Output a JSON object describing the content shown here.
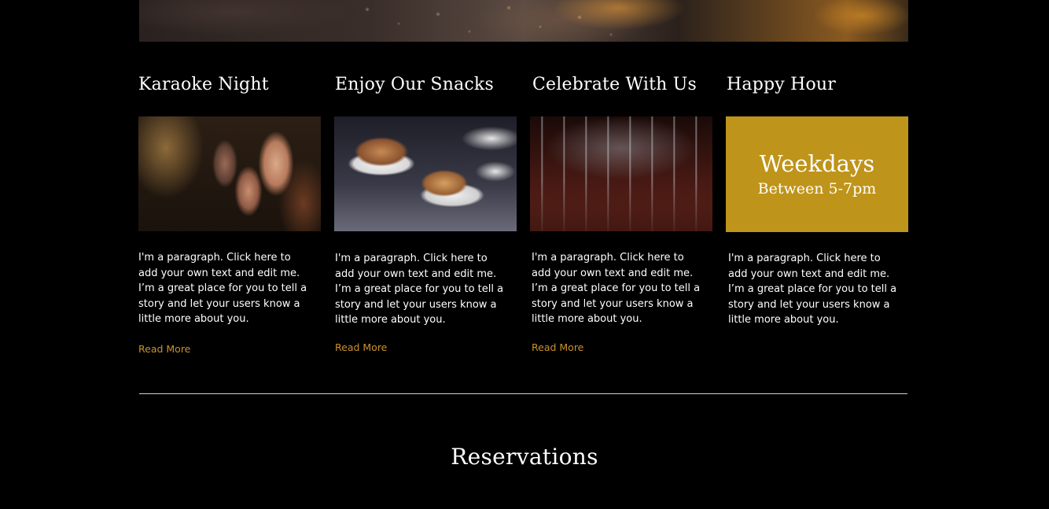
{
  "hero": {
    "image": "bar-drinks-photo"
  },
  "features": [
    {
      "title": "Karaoke Night",
      "image": "karaoke-crowd-photo",
      "text": "I'm a paragraph. Click here to add your own text and edit me. I’m a great place for you to tell a story and let your users know a little more about you.",
      "link": "Read More"
    },
    {
      "title": "Enjoy Our Snacks",
      "image": "snack-sliders-photo",
      "text": "I'm a paragraph. Click here to add your own text and edit me. I’m a great place for you to tell a story and let your users know a little more about you.",
      "link": "Read More"
    },
    {
      "title": "Celebrate With Us",
      "image": "shot-glasses-photo",
      "text": "I'm a paragraph. Click here to add your own text and edit me. I’m a great place for you to tell a story and let your users know a little more about you.",
      "link": "Read More"
    },
    {
      "title": "Happy Hour",
      "card_line1": "Weekdays",
      "card_line2": "Between 5-7pm",
      "text": "I'm a paragraph. Click here to add your own text and edit me. I’m a great place for you to tell a story and let your users know a little more about you."
    }
  ],
  "section": {
    "title": "Reservations"
  },
  "colors": {
    "background": "#000000",
    "accent_gold": "#bf941a",
    "link": "#c9922a",
    "text": "#ffffff"
  }
}
